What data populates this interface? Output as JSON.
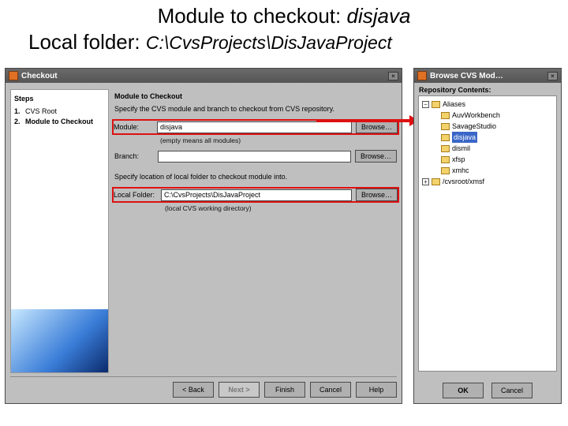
{
  "header": {
    "line1_prefix": "Module to checkout:  ",
    "line1_value": "disjava",
    "line2_prefix": "Local folder:  ",
    "line2_value": "C:\\CvsProjects\\DisJavaProject"
  },
  "checkout": {
    "title": "Checkout",
    "steps_heading": "Steps",
    "steps": [
      {
        "num": "1.",
        "label": "CVS Root"
      },
      {
        "num": "2.",
        "label": "Module to Checkout"
      }
    ],
    "panel_title": "Module to Checkout",
    "desc1": "Specify the CVS module and branch to checkout from CVS repository.",
    "module_label": "Module:",
    "module_value": "disjava",
    "hint_module": "(empty means all modules)",
    "branch_label": "Branch:",
    "branch_value": "",
    "desc2": "Specify location of local folder to checkout module into.",
    "local_label": "Local Folder:",
    "local_value": "C:\\CvsProjects\\DisJavaProject",
    "hint_local": "(local CVS working directory)",
    "browse": "Browse…",
    "buttons": {
      "back": "< Back",
      "next": "Next >",
      "finish": "Finish",
      "cancel": "Cancel",
      "help": "Help"
    }
  },
  "browse": {
    "title": "Browse CVS Mod…",
    "label": "Repository Contents:",
    "root": "Aliases",
    "items": [
      "AuvWorkbench",
      "SavageStudio",
      "disjava",
      "dismil",
      "xfsp",
      "xmhc"
    ],
    "selected_index": 2,
    "second_root": "/cvsroot/xmsf",
    "ok": "OK",
    "cancel": "Cancel"
  }
}
